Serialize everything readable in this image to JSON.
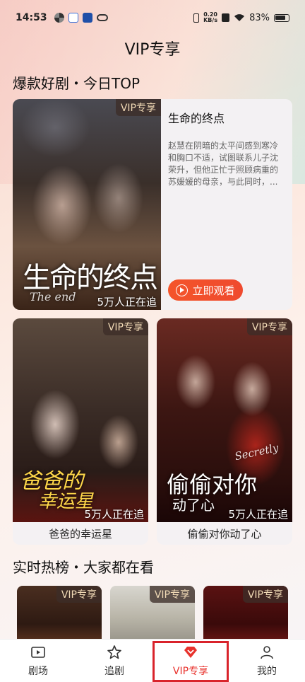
{
  "status_bar": {
    "time": "14:53",
    "net_speed_value": "0.20",
    "net_speed_unit": "KB/s",
    "battery": "83%"
  },
  "page": {
    "title": "VIP专享"
  },
  "section_top": {
    "title": "爆款好剧・今日TOP",
    "hero": {
      "tag": "VIP专享",
      "poster_title": "生命的终点",
      "poster_subtitle": "The end",
      "watching": "5万人正在追",
      "name": "生命的终点",
      "description": "赵慧在阴暗的太平间感到寒冷和胸口不适，试图联系儿子沈荣升，但他正忙于照顾病重的苏媛媛的母亲，与此同时，...",
      "watch_button": "立即观看"
    },
    "cards": [
      {
        "tag": "VIP专享",
        "poster_title_1": "爸爸的",
        "poster_title_2": "幸运星",
        "watching": "5万人正在追",
        "caption": "爸爸的幸运星"
      },
      {
        "tag": "VIP专享",
        "poster_title_1": "偷偷对你",
        "poster_title_2": "动了心",
        "poster_script": "Secretly",
        "watching": "5万人正在追",
        "caption": "偷偷对你动了心"
      }
    ]
  },
  "section_hot": {
    "title": "实时热榜・大家都在看",
    "cards": [
      {
        "tag": "VIP专享"
      },
      {
        "tag": "VIP专享"
      },
      {
        "tag": "VIP专享"
      }
    ]
  },
  "tabbar": {
    "tabs": [
      {
        "label": "剧场",
        "icon": "video-icon"
      },
      {
        "label": "追剧",
        "icon": "star-icon"
      },
      {
        "label": "VIP专享",
        "icon": "vip-diamond-icon",
        "active": true
      },
      {
        "label": "我的",
        "icon": "person-icon"
      }
    ]
  },
  "colors": {
    "accent": "#e8322c",
    "button": "#f4552a",
    "vip_tag_text": "#f0d9b5"
  }
}
